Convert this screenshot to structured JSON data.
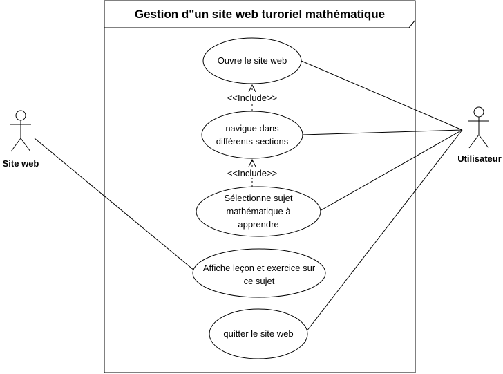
{
  "system": {
    "title": "Gestion d\"un site web turoriel mathématique"
  },
  "actors": {
    "site_web": {
      "label": "Site web"
    },
    "utilisateur": {
      "label": "Utilisateur"
    }
  },
  "use_cases": {
    "ouvre": {
      "lines": [
        "Ouvre le site web"
      ]
    },
    "navigue": {
      "lines": [
        "navigue dans",
        "différents sections"
      ]
    },
    "selectionne": {
      "lines": [
        "Sélectionne sujet",
        "mathématique à",
        "apprendre"
      ]
    },
    "affiche": {
      "lines": [
        "Affiche leçon et exercice sur",
        "ce sujet"
      ]
    },
    "quitter": {
      "lines": [
        "quitter le site web"
      ]
    }
  },
  "relations": {
    "include_1": "<<Include>>",
    "include_2": "<<Include>>"
  }
}
